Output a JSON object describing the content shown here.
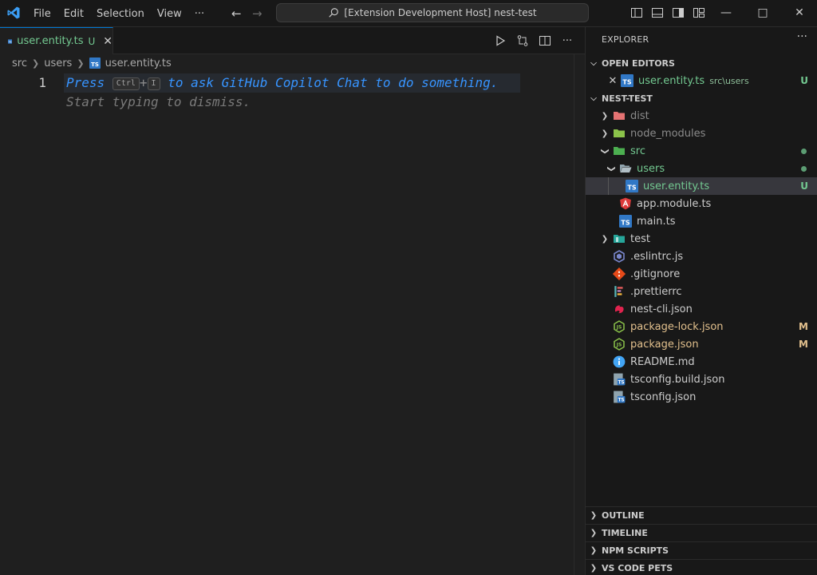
{
  "titlebar": {
    "menu": [
      "File",
      "Edit",
      "Selection",
      "View",
      "···"
    ],
    "command_center": "[Extension Development Host] nest-test",
    "window_controls": {
      "minimize": "—",
      "maximize": "□",
      "close": "✕"
    }
  },
  "tab": {
    "label": "user.entity.ts",
    "status": "U",
    "close": "✕"
  },
  "breadcrumb": [
    "src",
    "users",
    "user.entity.ts"
  ],
  "editor": {
    "line_number": "1",
    "hint_press": "Press ",
    "kbd_ctrl": "Ctrl",
    "kbd_plus": "+",
    "kbd_i": "I",
    "hint_rest": " to ask GitHub Copilot Chat to do something.",
    "hint_line2": "Start typing to dismiss."
  },
  "explorer": {
    "title": "EXPLORER",
    "more": "···",
    "open_editors": {
      "header": "OPEN EDITORS",
      "file": "user.entity.ts",
      "path": "src\\users",
      "status": "U"
    },
    "project": "NEST-TEST",
    "tree": {
      "dist": "dist",
      "node_modules": "node_modules",
      "src": "src",
      "users": "users",
      "user_entity": "user.entity.ts",
      "user_entity_status": "U",
      "app_module": "app.module.ts",
      "main": "main.ts",
      "test": "test",
      "eslintrc": ".eslintrc.js",
      "gitignore": ".gitignore",
      "prettierrc": ".prettierrc",
      "nest_cli": "nest-cli.json",
      "package_lock": "package-lock.json",
      "package_lock_status": "M",
      "package": "package.json",
      "package_status": "M",
      "readme": "README.md",
      "tsconfig_build": "tsconfig.build.json",
      "tsconfig": "tsconfig.json"
    },
    "bottom_sections": [
      "OUTLINE",
      "TIMELINE",
      "NPM SCRIPTS",
      "VS CODE PETS"
    ]
  },
  "colors": {
    "accent": "#0078d4",
    "untracked": "#73c991",
    "modified": "#e2c08d",
    "hint": "#3794ff"
  }
}
